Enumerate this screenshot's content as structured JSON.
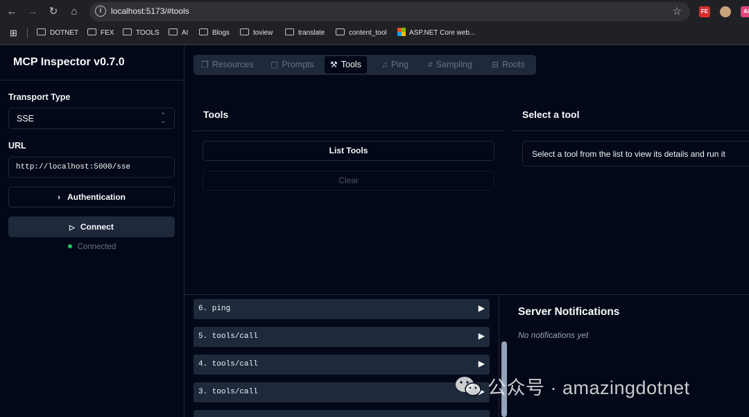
{
  "browser": {
    "url": "localhost:5173/#tools",
    "bookmarks": [
      "DOTNET",
      "FEX",
      "TOOLS",
      "AI",
      "Blogs",
      "toview",
      "translate",
      "content_tool",
      "ASP.NET Core web..."
    ],
    "extensions": [
      "FE",
      "",
      "Ai"
    ]
  },
  "sidebar": {
    "title": "MCP Inspector v0.7.0",
    "transport_label": "Transport Type",
    "transport_value": "SSE",
    "url_label": "URL",
    "url_value": "http://localhost:5000/sse",
    "auth_label": "Authentication",
    "connect_label": "Connect",
    "status": "Connected",
    "status_color": "#22c55e"
  },
  "tabs": [
    {
      "label": "Resources",
      "icon": "files-icon"
    },
    {
      "label": "Prompts",
      "icon": "message-icon"
    },
    {
      "label": "Tools",
      "icon": "hammer-icon",
      "active": true
    },
    {
      "label": "Ping",
      "icon": "bell-icon"
    },
    {
      "label": "Sampling",
      "icon": "hash-icon"
    },
    {
      "label": "Roots",
      "icon": "folder-tree-icon"
    }
  ],
  "tools": {
    "title": "Tools",
    "list_label": "List Tools",
    "clear_label": "Clear"
  },
  "detail": {
    "title": "Select a tool",
    "hint": "Select a tool from the list to view its details and run it"
  },
  "history": [
    {
      "label": "6. ping"
    },
    {
      "label": "5. tools/call"
    },
    {
      "label": "4. tools/call"
    },
    {
      "label": "3. tools/call"
    }
  ],
  "notifications": {
    "title": "Server Notifications",
    "empty": "No notifications yet"
  },
  "watermark": "公众号 · amazingdotnet"
}
